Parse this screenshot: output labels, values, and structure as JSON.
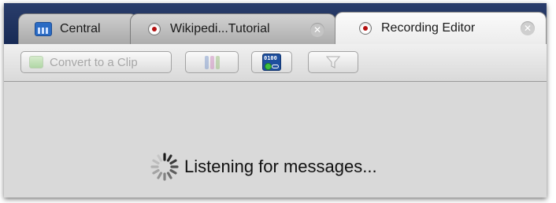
{
  "tabs": [
    {
      "label": "Central",
      "icon": "central-dashboard-icon",
      "active": false
    },
    {
      "label": "Wikipedi...Tutorial",
      "icon": "recording-icon",
      "active": false,
      "closable": true
    },
    {
      "label": "Recording Editor",
      "icon": "recording-icon",
      "active": true,
      "closable": true
    }
  ],
  "toolbar": {
    "convert_label": "Convert to a Clip",
    "convert_enabled": false,
    "buttons": [
      {
        "name": "columns-button",
        "icon": "columns-icon",
        "enabled": false
      },
      {
        "name": "binary-button",
        "icon": "binary-connect-icon",
        "enabled": true
      },
      {
        "name": "filter-button",
        "icon": "filter-icon",
        "enabled": false
      }
    ]
  },
  "status": {
    "text": "Listening for messages...",
    "icon": "spinner-icon"
  },
  "close_glyph": "✕"
}
